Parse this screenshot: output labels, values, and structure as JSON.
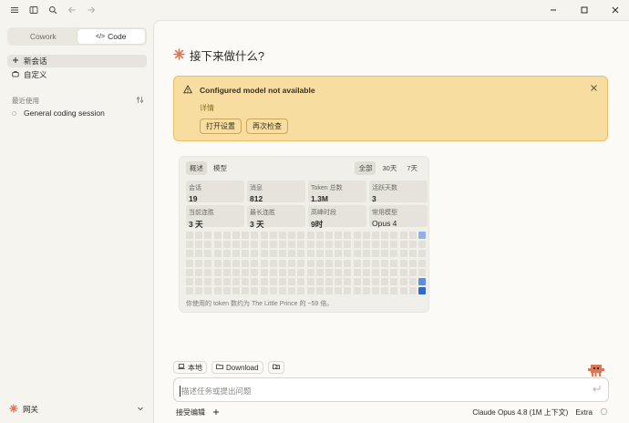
{
  "sidebar": {
    "mode_tabs": [
      {
        "label": "Cowork",
        "active": false
      },
      {
        "label": "Code",
        "active": true
      }
    ],
    "nav": [
      {
        "label": "新会话",
        "icon": "plus-icon",
        "active": true
      },
      {
        "label": "自定义",
        "icon": "briefcase-icon",
        "active": false
      }
    ],
    "recents_title": "最近使用",
    "recents": [
      {
        "label": "General coding session"
      }
    ],
    "footer_label": "网关"
  },
  "main": {
    "greeting": "接下来做什么?",
    "banner": {
      "title": "Configured model not available",
      "details": "详情",
      "open_settings": "打开设置",
      "recheck": "再次检查"
    },
    "stats": {
      "tabs": [
        {
          "label": "概述",
          "active": true
        },
        {
          "label": "模型",
          "active": false
        }
      ],
      "ranges": [
        {
          "label": "全部",
          "active": true
        },
        {
          "label": "30天",
          "active": false
        },
        {
          "label": "7天",
          "active": false
        }
      ],
      "cards": [
        {
          "label": "会话",
          "value": "19"
        },
        {
          "label": "消息",
          "value": "812"
        },
        {
          "label": "Token 总数",
          "value": "1.3M"
        },
        {
          "label": "活跃天数",
          "value": "3"
        },
        {
          "label": "当前连胜",
          "value": "3 天"
        },
        {
          "label": "最长连胜",
          "value": "3 天"
        },
        {
          "label": "高峰时段",
          "value": "9时"
        },
        {
          "label": "常用模型",
          "value": "Opus 4"
        }
      ],
      "footnote": "你使用的 token 数约为 The Little Prince 的 ~59 倍。"
    },
    "context_chips": [
      {
        "label": "本地",
        "icon": "laptop-icon"
      },
      {
        "label": "Download",
        "icon": "folder-icon"
      },
      {
        "label": "",
        "icon": "folder-refresh-icon"
      }
    ],
    "composer_placeholder": "描述任务或提出问题",
    "accept_edits": "接受编辑",
    "model_label": "Claude Opus 4.8 (1M 上下文)",
    "effort_label": "Extra"
  },
  "colors": {
    "accent": "#d97757",
    "banner_bg": "#f7dea0",
    "banner_border": "#e6c06a",
    "heat_empty": "#e2e0d9",
    "heat_light": "#8fb3e8",
    "heat_mid": "#5b8ee0",
    "heat_dark": "#2f67d4"
  },
  "heatmap": {
    "rows": 7,
    "cols": 26,
    "active_cells": [
      {
        "row": 0,
        "col": 25,
        "level": "light"
      },
      {
        "row": 5,
        "col": 25,
        "level": "mid"
      },
      {
        "row": 6,
        "col": 25,
        "level": "dark"
      }
    ]
  }
}
